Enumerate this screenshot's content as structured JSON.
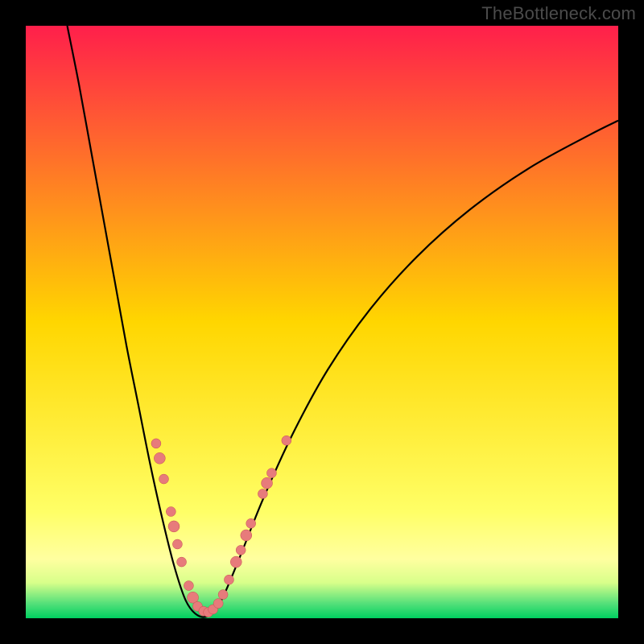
{
  "watermark": "TheBottleneck.com",
  "chart_data": {
    "type": "line",
    "title": "",
    "xlabel": "",
    "ylabel": "",
    "xlim": [
      0,
      100
    ],
    "ylim": [
      0,
      100
    ],
    "grid": false,
    "legend": false,
    "background_gradient": {
      "stops": [
        {
          "offset": 0.0,
          "color": "#ff1f4b"
        },
        {
          "offset": 0.5,
          "color": "#ffd600"
        },
        {
          "offset": 0.82,
          "color": "#ffff66"
        },
        {
          "offset": 0.9,
          "color": "#ffffa0"
        },
        {
          "offset": 0.94,
          "color": "#d8ff8a"
        },
        {
          "offset": 0.975,
          "color": "#55e07a"
        },
        {
          "offset": 1.0,
          "color": "#00d060"
        }
      ]
    },
    "series": [
      {
        "name": "bottleneck-curve",
        "stroke": "#000000",
        "points": [
          {
            "x": 7.0,
            "y": 100.0
          },
          {
            "x": 9.0,
            "y": 90.0
          },
          {
            "x": 11.0,
            "y": 79.0
          },
          {
            "x": 13.0,
            "y": 68.0
          },
          {
            "x": 15.0,
            "y": 57.0
          },
          {
            "x": 17.0,
            "y": 46.0
          },
          {
            "x": 19.0,
            "y": 36.0
          },
          {
            "x": 21.0,
            "y": 26.0
          },
          {
            "x": 23.0,
            "y": 17.0
          },
          {
            "x": 25.0,
            "y": 9.0
          },
          {
            "x": 27.0,
            "y": 3.0
          },
          {
            "x": 29.0,
            "y": 0.5
          },
          {
            "x": 31.0,
            "y": 0.5
          },
          {
            "x": 33.0,
            "y": 3.0
          },
          {
            "x": 36.0,
            "y": 10.0
          },
          {
            "x": 40.0,
            "y": 20.0
          },
          {
            "x": 45.0,
            "y": 31.0
          },
          {
            "x": 51.0,
            "y": 42.0
          },
          {
            "x": 58.0,
            "y": 52.0
          },
          {
            "x": 66.0,
            "y": 61.0
          },
          {
            "x": 75.0,
            "y": 69.0
          },
          {
            "x": 85.0,
            "y": 76.0
          },
          {
            "x": 95.0,
            "y": 81.5
          },
          {
            "x": 100.0,
            "y": 84.0
          }
        ]
      }
    ],
    "markers": {
      "name": "sample-dots",
      "fill": "#e77b7b",
      "stroke": "#c64f4f",
      "points": [
        {
          "x": 22.0,
          "y": 29.5,
          "r": 6
        },
        {
          "x": 22.6,
          "y": 27.0,
          "r": 7
        },
        {
          "x": 23.3,
          "y": 23.5,
          "r": 6
        },
        {
          "x": 24.5,
          "y": 18.0,
          "r": 6
        },
        {
          "x": 25.0,
          "y": 15.5,
          "r": 7
        },
        {
          "x": 25.6,
          "y": 12.5,
          "r": 6
        },
        {
          "x": 26.3,
          "y": 9.5,
          "r": 6
        },
        {
          "x": 27.5,
          "y": 5.5,
          "r": 6
        },
        {
          "x": 28.2,
          "y": 3.5,
          "r": 7
        },
        {
          "x": 29.0,
          "y": 2.0,
          "r": 6
        },
        {
          "x": 30.0,
          "y": 1.2,
          "r": 6
        },
        {
          "x": 30.8,
          "y": 1.0,
          "r": 6
        },
        {
          "x": 31.6,
          "y": 1.5,
          "r": 6
        },
        {
          "x": 32.5,
          "y": 2.5,
          "r": 6
        },
        {
          "x": 33.3,
          "y": 4.0,
          "r": 6
        },
        {
          "x": 34.3,
          "y": 6.5,
          "r": 6
        },
        {
          "x": 35.5,
          "y": 9.5,
          "r": 7
        },
        {
          "x": 36.3,
          "y": 11.5,
          "r": 6
        },
        {
          "x": 37.2,
          "y": 14.0,
          "r": 7
        },
        {
          "x": 38.0,
          "y": 16.0,
          "r": 6
        },
        {
          "x": 40.0,
          "y": 21.0,
          "r": 6
        },
        {
          "x": 40.7,
          "y": 22.8,
          "r": 7
        },
        {
          "x": 41.5,
          "y": 24.5,
          "r": 6
        },
        {
          "x": 44.0,
          "y": 30.0,
          "r": 6
        }
      ]
    }
  }
}
